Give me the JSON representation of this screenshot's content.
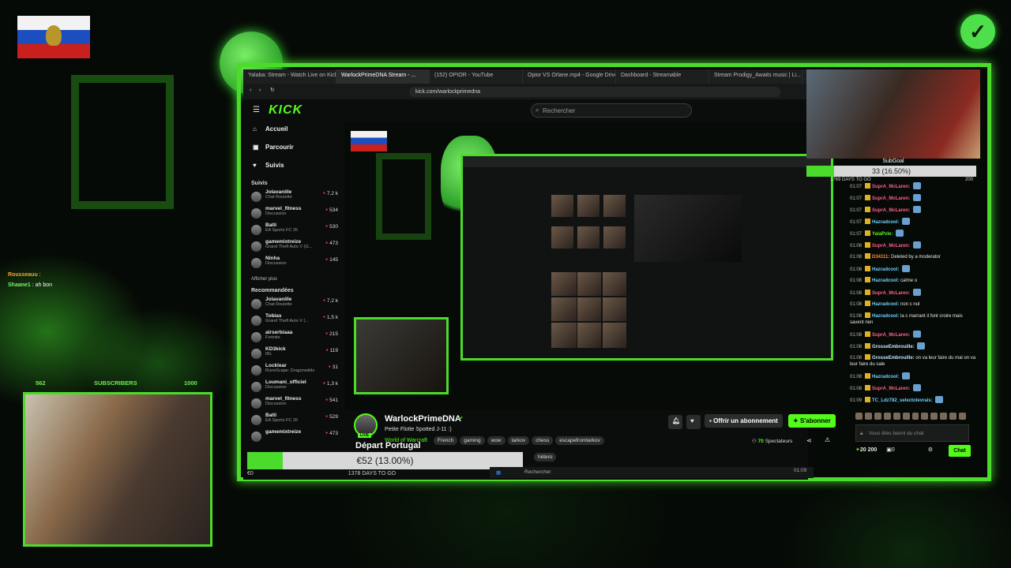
{
  "browser": {
    "tabs": [
      "Yalaba: Stream - Watch Live on Kick",
      "WarlockPrimeDNA Stream - ...",
      "(152) OPIOR - YouTube",
      "Opior VS Orlane.mp4 - Google Drive",
      "Dashboard - Streamable",
      "Stream Prodigy_Awaits music | Li..."
    ],
    "url": "kick.com/warlockprimedna"
  },
  "kick": {
    "logo": "KICK",
    "search_placeholder": "Rechercher",
    "nav": [
      "Accueil",
      "Parcourir",
      "Suivis"
    ],
    "followed_title": "Suivis",
    "followed": [
      {
        "name": "Jolavanille",
        "cat": "Chat Roulette",
        "viewers": "7,2 k"
      },
      {
        "name": "marvel_fitness",
        "cat": "Discussion",
        "viewers": "534"
      },
      {
        "name": "Balti",
        "cat": "EA Sports FC 26",
        "viewers": "530"
      },
      {
        "name": "gamemixtreize",
        "cat": "Grand Theft Auto V (G...",
        "viewers": "473"
      },
      {
        "name": "Ninha",
        "cat": "Discussion",
        "viewers": "145"
      }
    ],
    "show_more": "Afficher plus",
    "recommended_title": "Recommandées",
    "recommended": [
      {
        "name": "Jolavanille",
        "cat": "Chat Roulette",
        "viewers": "7,2 k"
      },
      {
        "name": "Tobias",
        "cat": "Grand Theft Auto V (...",
        "viewers": "1,5 k"
      },
      {
        "name": "airserbiaaa",
        "cat": "Fortnite",
        "viewers": "215"
      },
      {
        "name": "KD3kick",
        "cat": "IRL",
        "viewers": "119"
      },
      {
        "name": "Locklear",
        "cat": "RuneScape: Dragonwilds",
        "viewers": "31"
      },
      {
        "name": "Loumani_officiel",
        "cat": "Discussion",
        "viewers": "1,3 k"
      },
      {
        "name": "marvel_fitness",
        "cat": "Discussion",
        "viewers": "541"
      },
      {
        "name": "Balti",
        "cat": "EA Sports FC 26",
        "viewers": "529"
      },
      {
        "name": "gamemixtreize",
        "cat": "",
        "viewers": "473"
      }
    ],
    "streamer": {
      "name": "WarlockPrimeDNA",
      "title": "Petite Flotte Spotted J-11 :)",
      "category": "World of Warcraft",
      "tags": [
        "French",
        "gaming",
        "wow",
        "tarkov",
        "chess",
        "escapefromtarkov"
      ],
      "tag_extra": "hétero",
      "live": "LIVE"
    },
    "subscribe_offer": "Offrir un abonnement",
    "subscribe": "S'abonner",
    "viewers_count": "70",
    "viewers_label": "Spectateurs",
    "chat_banned": "Vous êtes banni du chat",
    "chat_button": "Chat",
    "points": "20 200",
    "gift_count": "0"
  },
  "overlay": {
    "depart": "Départ Portugal",
    "goal_text": "€52 (13.00%)",
    "goal_fraction": 0.13,
    "goal_left": "€0",
    "goal_days": "1378 DAYS TO GO",
    "subgoal_title": "SubGoal",
    "subgoal_text": "33 (16.50%)",
    "subgoal_fraction": 0.165,
    "subgoal_days": "1769 DAYS TO GO",
    "subgoal_max": "200",
    "webcam_header_left": "562",
    "webcam_header_mid": "SUBSCRIBERS",
    "webcam_header_right": "1000",
    "overlay_chat": [
      {
        "user": "Rousseauu",
        "text": ""
      },
      {
        "user": "Shaane1",
        "text": "ah bon"
      }
    ],
    "taskbar_search": "Rechercher",
    "taskbar_time": "01:09"
  },
  "chat": [
    {
      "time": "01:07",
      "user": "SuprA_McLaren:",
      "text": "",
      "color": "#ff5d8f"
    },
    {
      "time": "01:07",
      "user": "SuprA_McLaren:",
      "text": "",
      "color": "#ff5d8f"
    },
    {
      "time": "01:07",
      "user": "SuprA_McLaren:",
      "text": "",
      "color": "#ff5d8f"
    },
    {
      "time": "01:07",
      "user": "Hazradcool:",
      "text": "",
      "color": "#6ad0ff"
    },
    {
      "time": "01:07",
      "user": "YalaPvle:",
      "text": "",
      "color": "#53fc18"
    },
    {
      "time": "01:08",
      "user": "SuprA_McLaren:",
      "text": "",
      "color": "#ff5d8f"
    },
    {
      "time": "01:08",
      "user": "D34111:",
      "text": "Deleted by a moderator",
      "color": "#ff8a3c"
    },
    {
      "time": "01:08",
      "user": "Hazradcool:",
      "text": "",
      "color": "#6ad0ff"
    },
    {
      "time": "01:08",
      "user": "Hazradcool:",
      "text": "calme o",
      "color": "#6ad0ff"
    },
    {
      "time": "01:08",
      "user": "SuprA_McLaren:",
      "text": "",
      "color": "#ff5d8f"
    },
    {
      "time": "01:08",
      "user": "Hazradcool:",
      "text": "non c nul",
      "color": "#6ad0ff"
    },
    {
      "time": "01:08",
      "user": "Hazradcool:",
      "text": "la c marrant il font croire mais savent rien",
      "color": "#6ad0ff"
    },
    {
      "time": "01:08",
      "user": "SuprA_McLaren:",
      "text": "",
      "color": "#ff5d8f"
    },
    {
      "time": "01:08",
      "user": "GrosseEmbrouille:",
      "text": "",
      "color": "#bfe6ff"
    },
    {
      "time": "01:08",
      "user": "GrosseEmbrouille:",
      "text": "on va leur faire du mal on va leur faire du sale",
      "color": "#bfe6ff"
    },
    {
      "time": "01:08",
      "user": "Hazradcool:",
      "text": "",
      "color": "#6ad0ff"
    },
    {
      "time": "01:08",
      "user": "SuprA_McLaren:",
      "text": "",
      "color": "#ff5d8f"
    },
    {
      "time": "01:09",
      "user": "TC_Ldz782_selectolevrais:",
      "text": "",
      "color": "#6ad0ff"
    }
  ]
}
